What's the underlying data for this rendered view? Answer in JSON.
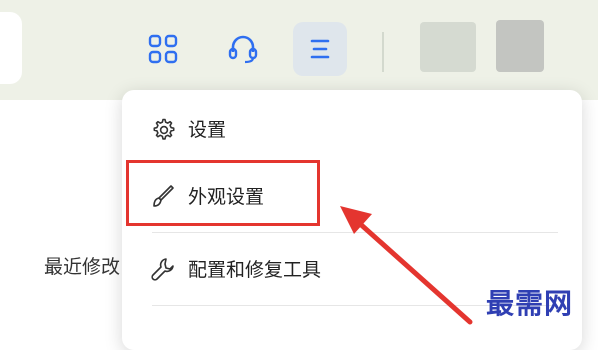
{
  "toolbar": {
    "apps_icon": "grid-icon",
    "support_icon": "headset-icon",
    "menu_icon": "menu-icon"
  },
  "page": {
    "recent_label": "最近修改"
  },
  "menu": {
    "items": [
      {
        "label": "设置",
        "icon": "gear-icon"
      },
      {
        "label": "外观设置",
        "icon": "brush-icon"
      },
      {
        "label": "配置和修复工具",
        "icon": "wrench-icon"
      }
    ]
  },
  "annotation": {
    "highlight_color": "#e4352f"
  },
  "watermark": {
    "text": "最需网"
  }
}
